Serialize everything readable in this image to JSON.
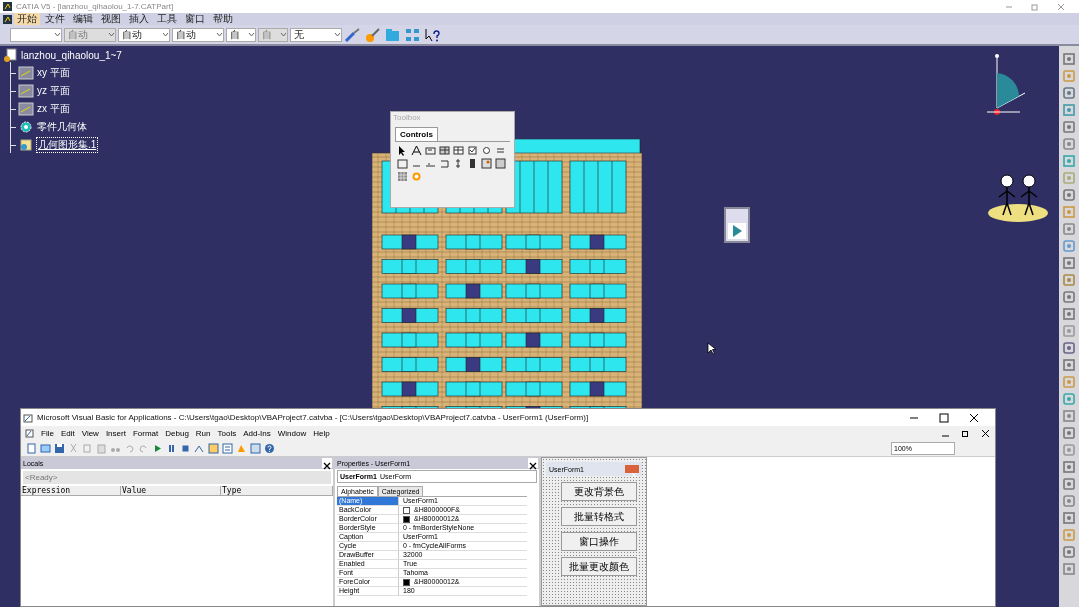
{
  "catia": {
    "title": "CATIA V5 - [lanzhou_qihaolou_1-7.CATPart]",
    "menu": [
      {
        "label": "开始",
        "selected": true
      },
      {
        "label": "文件",
        "selected": false
      },
      {
        "label": "编辑",
        "selected": false
      },
      {
        "label": "视图",
        "selected": false
      },
      {
        "label": "插入",
        "selected": false
      },
      {
        "label": "工具",
        "selected": false
      },
      {
        "label": "窗口",
        "selected": false
      },
      {
        "label": "帮助",
        "selected": false
      }
    ],
    "combos": [
      {
        "disabled": false
      },
      {
        "value": "自动",
        "disabled": true
      },
      {
        "value": "自动",
        "disabled": false
      },
      {
        "value": "自动",
        "disabled": false
      },
      {
        "value": "自",
        "disabled": false
      },
      {
        "value": "自",
        "disabled": true
      },
      {
        "value": "无",
        "disabled": false
      }
    ]
  },
  "tree": {
    "root": "lanzhou_qihaolou_1~7",
    "children": [
      {
        "label": "xy 平面",
        "kind": "plane",
        "selected": false
      },
      {
        "label": "yz 平面",
        "kind": "plane",
        "selected": false
      },
      {
        "label": "zx 平面",
        "kind": "plane",
        "selected": false
      },
      {
        "label": "零件几何体",
        "kind": "body",
        "selected": false
      },
      {
        "label": "几何图形集.1",
        "kind": "set",
        "selected": true
      }
    ]
  },
  "toolbox": {
    "title": "Toolbox",
    "tabs": [
      {
        "label": "Controls",
        "selected": true
      }
    ]
  },
  "vba": {
    "title": "Microsoft Visual Basic for Applications - C:\\Users\\tgao\\Desktop\\VBAProject7.catvba - [C:\\Users\\tgao\\Desktop\\VBAProject7.catvba - UserForm1 (UserForm)]",
    "menu": [
      "File",
      "Edit",
      "View",
      "Insert",
      "Format",
      "Debug",
      "Run",
      "Tools",
      "Add-Ins",
      "Window",
      "Help"
    ],
    "zoom": "100%",
    "locals": {
      "title": "Locals",
      "status": "<Ready>",
      "columns": [
        "Expression",
        "Value",
        "Type"
      ]
    },
    "properties": {
      "title": "Properties - UserForm1",
      "object_name": "UserForm1",
      "object_type": "UserForm",
      "tabs": [
        {
          "label": "Alphabetic",
          "selected": true
        },
        {
          "label": "Categorized",
          "selected": false
        }
      ],
      "rows": [
        {
          "name": "(Name)",
          "value": "UserForm1",
          "selected": true
        },
        {
          "name": "BackColor",
          "value": "&H8000000F&",
          "color": "#ffffff",
          "selected": false
        },
        {
          "name": "BorderColor",
          "value": "&H80000012&",
          "color": "#000000",
          "selected": false
        },
        {
          "name": "BorderStyle",
          "value": "0 - fmBorderStyleNone",
          "selected": false
        },
        {
          "name": "Caption",
          "value": "UserForm1",
          "selected": false
        },
        {
          "name": "Cycle",
          "value": "0 - fmCycleAllForms",
          "selected": false
        },
        {
          "name": "DrawBuffer",
          "value": "32000",
          "selected": false
        },
        {
          "name": "Enabled",
          "value": "True",
          "selected": false
        },
        {
          "name": "Font",
          "value": "Tahoma",
          "selected": false
        },
        {
          "name": "ForeColor",
          "value": "&H80000012&",
          "color": "#000000",
          "selected": false
        },
        {
          "name": "Height",
          "value": "180",
          "selected": false
        }
      ]
    },
    "userform": {
      "title": "UserForm1",
      "buttons": [
        "更改背景色",
        "批量转格式",
        "窗口操作",
        "批量更改颜色"
      ]
    }
  }
}
